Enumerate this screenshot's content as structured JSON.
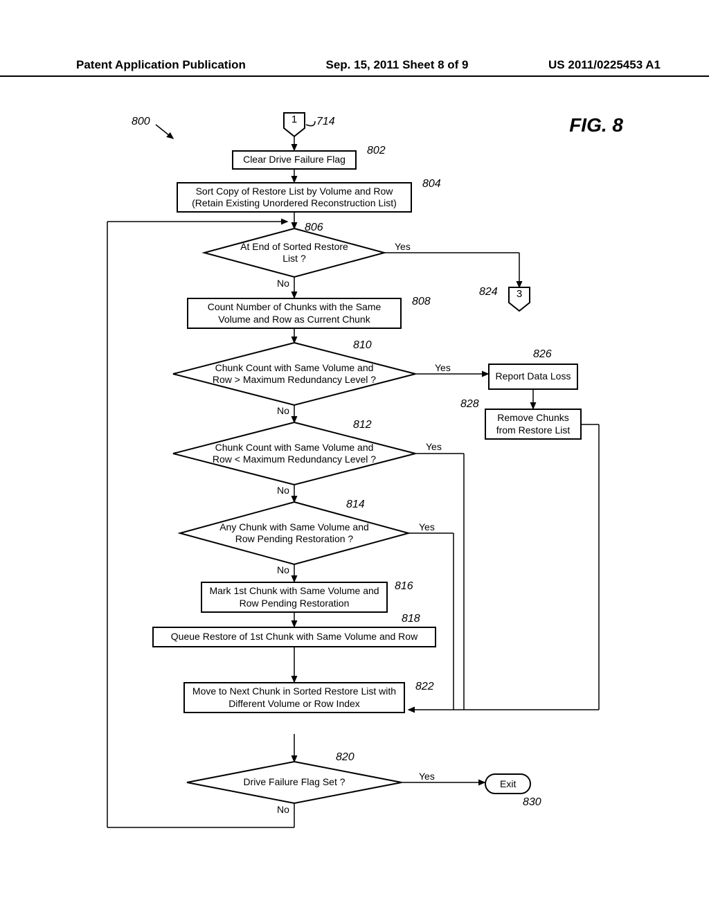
{
  "header": {
    "left": "Patent Application Publication",
    "center": "Sep. 15, 2011  Sheet 8 of 9",
    "right": "US 2011/0225453 A1"
  },
  "figure": {
    "title": "FIG. 8",
    "ref_800": "800",
    "ref_714": "714",
    "ref_802": "802",
    "ref_804": "804",
    "ref_806": "806",
    "ref_808": "808",
    "ref_810": "810",
    "ref_812": "812",
    "ref_814": "814",
    "ref_816": "816",
    "ref_818": "818",
    "ref_820": "820",
    "ref_822": "822",
    "ref_824": "824",
    "ref_826": "826",
    "ref_828": "828",
    "ref_830": "830",
    "connector_1": "1",
    "connector_3": "3",
    "box_802": "Clear Drive Failure Flag",
    "box_804": "Sort Copy of Restore List by Volume and Row (Retain Existing Unordered Reconstruction List)",
    "dec_806": "At End of Sorted Restore List ?",
    "box_808": "Count Number of Chunks with the Same Volume and Row as Current Chunk",
    "dec_810": "Chunk Count with Same Volume and Row > Maximum Redundancy Level ?",
    "dec_812": "Chunk Count with Same Volume and Row < Maximum Redundancy Level ?",
    "dec_814": "Any Chunk with Same Volume and Row Pending Restoration ?",
    "box_816": "Mark 1st Chunk with Same Volume and Row Pending Restoration",
    "box_818": "Queue Restore of 1st Chunk with Same Volume and Row",
    "box_822": "Move to Next Chunk in Sorted Restore List with Different Volume or Row Index",
    "dec_820": "Drive Failure Flag Set ?",
    "box_826": "Report Data Loss",
    "box_828": "Remove Chunks from Restore List",
    "exit": "Exit",
    "yes": "Yes",
    "no": "No"
  }
}
